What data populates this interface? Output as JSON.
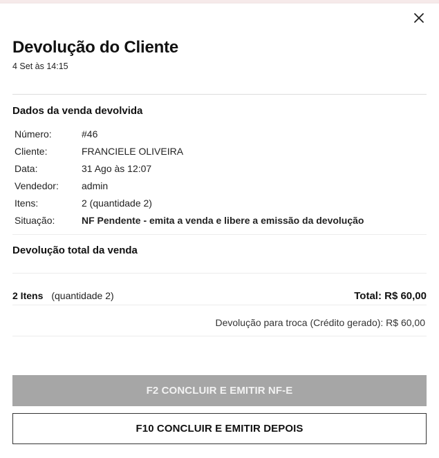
{
  "modal": {
    "title": "Devolução do Cliente",
    "subtitle": "4 Set às 14:15"
  },
  "sale_section": {
    "title": "Dados da venda devolvida",
    "fields": [
      {
        "label": "Número:",
        "value": "#46"
      },
      {
        "label": "Cliente:",
        "value": "FRANCIELE OLIVEIRA"
      },
      {
        "label": "Data:",
        "value": "31 Ago às 12:07"
      },
      {
        "label": "Vendedor:",
        "value": "admin"
      },
      {
        "label": "Itens:",
        "value": "2 (quantidade 2)"
      },
      {
        "label": "Situação:",
        "value": "NF Pendente - emita a venda e libere a emissão da devolução"
      }
    ]
  },
  "return_section": {
    "title": "Devolução total da venda"
  },
  "summary": {
    "items_count": "2 Itens",
    "quantity": "(quantidade 2)",
    "total": "Total: R$ 60,00",
    "credit": "Devolução para troca (Crédito gerado): R$ 60,00"
  },
  "buttons": {
    "primary_label": "F2 CONCLUIR E EMITIR NF-E",
    "secondary_label": "F10 CONCLUIR E EMITIR DEPOIS"
  },
  "icons": {
    "close": "close-icon"
  },
  "colors": {
    "primary_button_bg": "#a6a6a6",
    "divider": "#dcdcdc"
  }
}
